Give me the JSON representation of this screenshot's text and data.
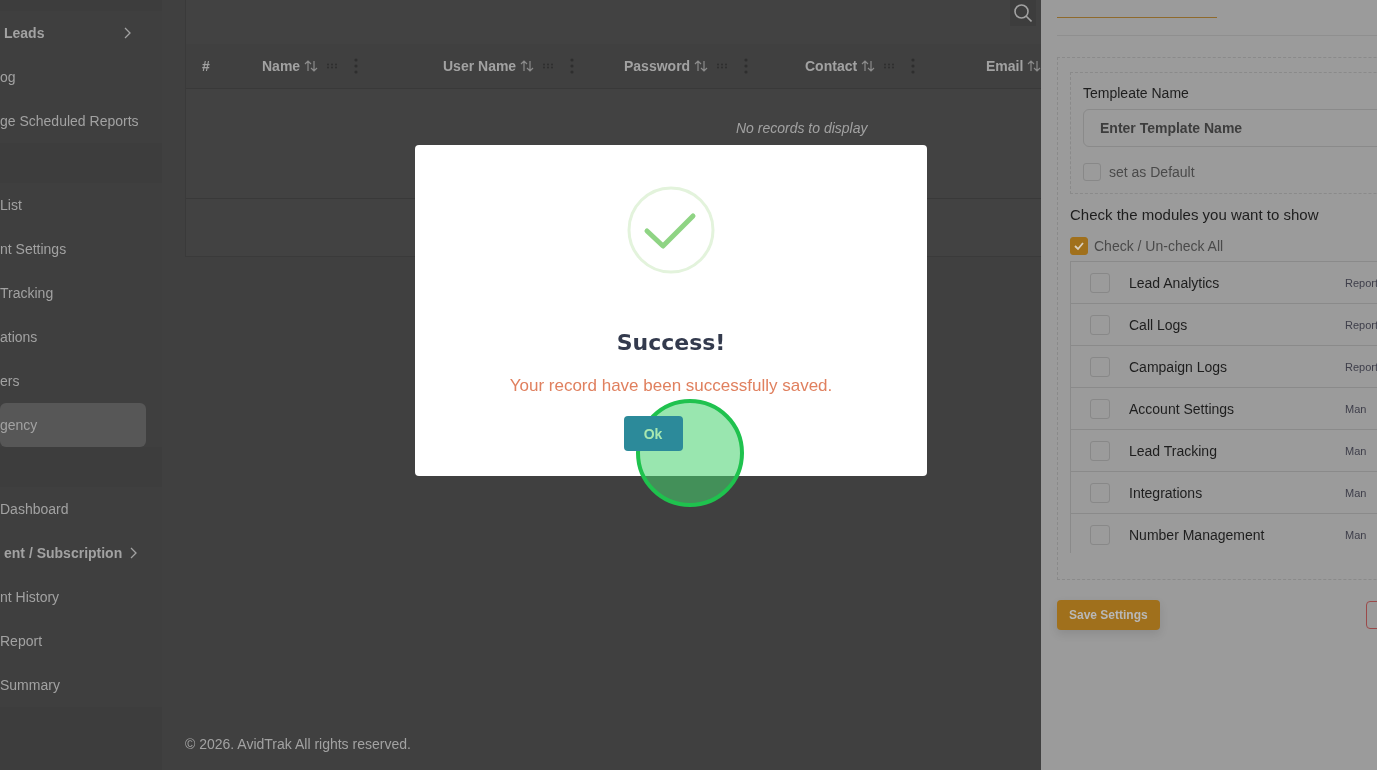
{
  "sidebar": {
    "groups": [
      {
        "items": [
          {
            "label": "Leads",
            "kind": "group",
            "selected": false
          },
          {
            "label": "og",
            "kind": "link",
            "selected": false
          },
          {
            "label": "ge Scheduled Reports",
            "kind": "link",
            "selected": false
          }
        ]
      },
      {
        "items": [
          {
            "label": "List",
            "kind": "link",
            "selected": false
          },
          {
            "label": "nt Settings",
            "kind": "link",
            "selected": false
          },
          {
            "label": "Tracking",
            "kind": "link",
            "selected": false
          },
          {
            "label": "ations",
            "kind": "link",
            "selected": false
          },
          {
            "label": "ers",
            "kind": "link",
            "selected": false
          },
          {
            "label": "gency",
            "kind": "link",
            "selected": true
          }
        ]
      },
      {
        "items": [
          {
            "label": "Dashboard",
            "kind": "link",
            "selected": false
          },
          {
            "label": "ent / Subscription",
            "kind": "group",
            "selected": false
          },
          {
            "label": "nt History",
            "kind": "link",
            "selected": false
          },
          {
            "label": "Report",
            "kind": "link",
            "selected": false
          },
          {
            "label": "Summary",
            "kind": "link",
            "selected": false
          }
        ]
      }
    ]
  },
  "table": {
    "columns": [
      {
        "label": "#",
        "sortable": false
      },
      {
        "label": "Name",
        "sortable": true
      },
      {
        "label": "User Name",
        "sortable": true
      },
      {
        "label": "Password",
        "sortable": true
      },
      {
        "label": "Contact",
        "sortable": true
      },
      {
        "label": "Email",
        "sortable": true
      }
    ],
    "empty_message": "No records to display"
  },
  "footer": "© 2026. AvidTrak All rights reserved.",
  "drawer": {
    "template_label": "Templeate Name",
    "template_placeholder": "Enter Template Name",
    "default": {
      "label": "set as Default",
      "checked": false
    },
    "modules_heading": "Check the modules you want to show",
    "check_all": {
      "label": "Check / Un-check All",
      "checked": true
    },
    "modules": [
      {
        "name": "Lead Analytics",
        "category": "Report",
        "checked": false
      },
      {
        "name": "Call Logs",
        "category": "Report",
        "checked": false
      },
      {
        "name": "Campaign Logs",
        "category": "Report",
        "checked": false
      },
      {
        "name": "Account Settings",
        "category": "Man",
        "checked": false
      },
      {
        "name": "Lead Tracking",
        "category": "Man",
        "checked": false
      },
      {
        "name": "Integrations",
        "category": "Man",
        "checked": false
      },
      {
        "name": "Number Management",
        "category": "Man",
        "checked": false
      }
    ],
    "save_button": "Save Settings"
  },
  "modal": {
    "title": "Success!",
    "message": "Your record have been successfully saved.",
    "button": "Ok"
  }
}
